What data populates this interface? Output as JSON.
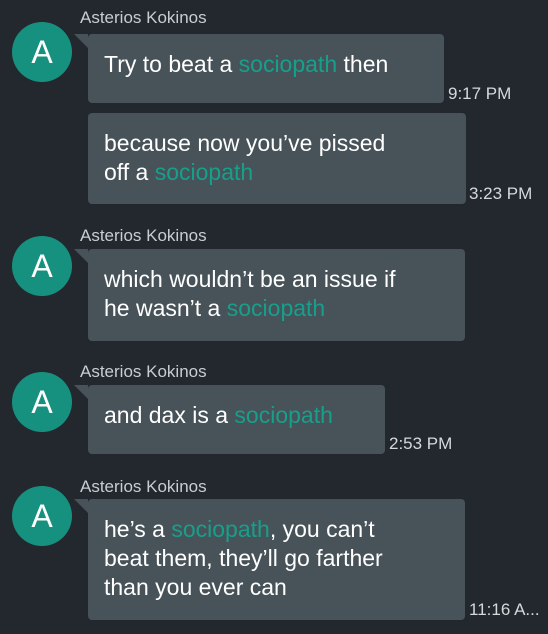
{
  "sender_name": "Asterios Kokinos",
  "avatar_letter": "A",
  "colors": {
    "background": "#22282e",
    "bubble": "#475359",
    "avatar": "#17917f",
    "link": "#16a08c"
  },
  "messages": [
    {
      "parts": [
        "Try to beat a ",
        "sociopath",
        " then"
      ],
      "time": "9:17 PM"
    },
    {
      "parts": [
        "because now you’ve pissed off a ",
        "sociopath",
        ""
      ],
      "time": "3:23 PM"
    },
    {
      "parts": [
        "which wouldn’t be an issue if he wasn’t a ",
        "sociopath",
        ""
      ],
      "time": ""
    },
    {
      "parts": [
        "and dax is a ",
        "sociopath",
        ""
      ],
      "time": "2:53 PM"
    },
    {
      "parts": [
        "he’s a ",
        "sociopath",
        ", you can’t beat them, they’ll go farther than you ever can"
      ],
      "time": "11:16 A..."
    }
  ]
}
